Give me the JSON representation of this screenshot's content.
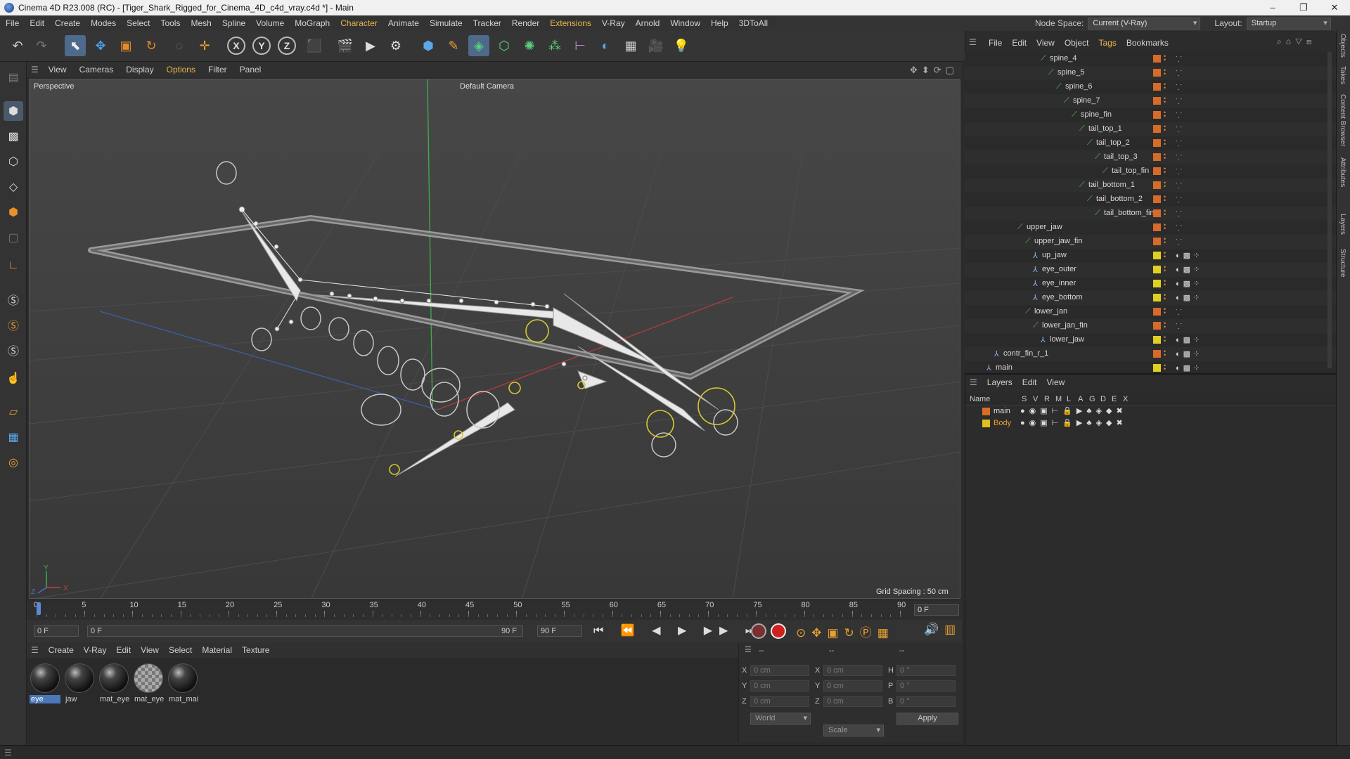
{
  "window": {
    "title": "Cinema 4D R23.008 (RC) - [Tiger_Shark_Rigged_for_Cinema_4D_c4d_vray.c4d *] - Main",
    "minimize": "–",
    "maximize": "❐",
    "close": "✕"
  },
  "menubar": [
    "File",
    "Edit",
    "Create",
    "Modes",
    "Select",
    "Tools",
    "Mesh",
    "Spline",
    "Volume",
    "MoGraph",
    "Character",
    "Animate",
    "Simulate",
    "Tracker",
    "Render",
    "Extensions",
    "V-Ray",
    "Arnold",
    "Window",
    "Help",
    "3DToAll"
  ],
  "nodespace": {
    "label": "Node Space:",
    "value": "Current (V-Ray)",
    "layout_label": "Layout:",
    "layout_value": "Startup"
  },
  "viewport_menu": [
    "View",
    "Cameras",
    "Display",
    "Options",
    "Filter",
    "Panel"
  ],
  "viewport": {
    "label": "Perspective",
    "camera": "Default Camera",
    "grid_spacing": "Grid Spacing : 50 cm"
  },
  "timeline": {
    "ticks": [
      "0",
      "5",
      "10",
      "15",
      "20",
      "25",
      "30",
      "35",
      "40",
      "45",
      "50",
      "55",
      "60",
      "65",
      "70",
      "75",
      "80",
      "85",
      "90"
    ],
    "current_frame": "0 F"
  },
  "transport": {
    "start": "0 F",
    "start2": "0 F",
    "end": "90 F",
    "end2": "90 F"
  },
  "material_menu": [
    "Create",
    "V-Ray",
    "Edit",
    "View",
    "Select",
    "Material",
    "Texture"
  ],
  "materials": [
    {
      "name": "eye",
      "selected": true
    },
    {
      "name": "jaw"
    },
    {
      "name": "mat_eye"
    },
    {
      "name": "mat_eye",
      "checker": true
    },
    {
      "name": "mat_mai"
    }
  ],
  "coords": {
    "dash1": "--",
    "dash2": "--",
    "dash3": "--",
    "x": "X",
    "y": "Y",
    "z": "Z",
    "h": "H",
    "p": "P",
    "b": "B",
    "pos_x": "0 cm",
    "pos_y": "0 cm",
    "pos_z": "0 cm",
    "size_x": "0 cm",
    "size_y": "0 cm",
    "size_z": "0 cm",
    "rot_h": "0 °",
    "rot_p": "0 °",
    "rot_b": "0 °",
    "world": "World",
    "scale": "Scale",
    "apply": "Apply"
  },
  "object_menu": [
    "File",
    "Edit",
    "View",
    "Object",
    "Tags",
    "Bookmarks"
  ],
  "objects": [
    {
      "name": "spine_4",
      "indent": 8,
      "color": "#d86a2a"
    },
    {
      "name": "spine_5",
      "indent": 9,
      "color": "#d86a2a"
    },
    {
      "name": "spine_6",
      "indent": 10,
      "color": "#d86a2a"
    },
    {
      "name": "spine_7",
      "indent": 11,
      "color": "#d86a2a"
    },
    {
      "name": "spine_fin",
      "indent": 12,
      "color": "#d86a2a"
    },
    {
      "name": "tail_top_1",
      "indent": 13,
      "color": "#d86a2a"
    },
    {
      "name": "tail_top_2",
      "indent": 14,
      "color": "#d86a2a"
    },
    {
      "name": "tail_top_3",
      "indent": 15,
      "color": "#d86a2a"
    },
    {
      "name": "tail_top_fin",
      "indent": 16,
      "color": "#d86a2a"
    },
    {
      "name": "tail_bottom_1",
      "indent": 13,
      "color": "#d86a2a"
    },
    {
      "name": "tail_bottom_2",
      "indent": 14,
      "color": "#d86a2a"
    },
    {
      "name": "tail_bottom_fin",
      "indent": 15,
      "color": "#d86a2a"
    },
    {
      "name": "upper_jaw",
      "indent": 5,
      "color": "#d86a2a"
    },
    {
      "name": "upper_jaw_fin",
      "indent": 6,
      "color": "#d86a2a"
    },
    {
      "name": "up_jaw",
      "indent": 7,
      "color": "#e0d020",
      "joint": true
    },
    {
      "name": "eye_outer",
      "indent": 7,
      "color": "#e0d020",
      "joint": true
    },
    {
      "name": "eye_inner",
      "indent": 7,
      "color": "#e0d020",
      "joint": true
    },
    {
      "name": "eye_bottom",
      "indent": 7,
      "color": "#e0d020",
      "joint": true
    },
    {
      "name": "lower_jan",
      "indent": 6,
      "color": "#d86a2a"
    },
    {
      "name": "lower_jan_fin",
      "indent": 7,
      "color": "#d86a2a"
    },
    {
      "name": "lower_jaw",
      "indent": 8,
      "color": "#e0d020",
      "joint": true
    },
    {
      "name": "contr_fin_r_1",
      "indent": 2,
      "color": "#d86a2a",
      "joint": true
    },
    {
      "name": "main",
      "indent": 1,
      "color": "#e0d020",
      "joint": true
    }
  ],
  "layer_menu": [
    "Layers",
    "Edit",
    "View"
  ],
  "layer_columns": [
    "Name",
    "S",
    "V",
    "R",
    "M",
    "L",
    "A",
    "G",
    "D",
    "E",
    "X"
  ],
  "layers": [
    {
      "name": "main",
      "color": "#d86a2a"
    },
    {
      "name": "Body",
      "color": "#e0c020"
    }
  ],
  "side_tabs": [
    "Objects",
    "Takes",
    "Content Browser",
    "Attributes",
    "Layers",
    "Structure"
  ],
  "axis": {
    "x": "X",
    "y": "Y",
    "z": "Z"
  }
}
